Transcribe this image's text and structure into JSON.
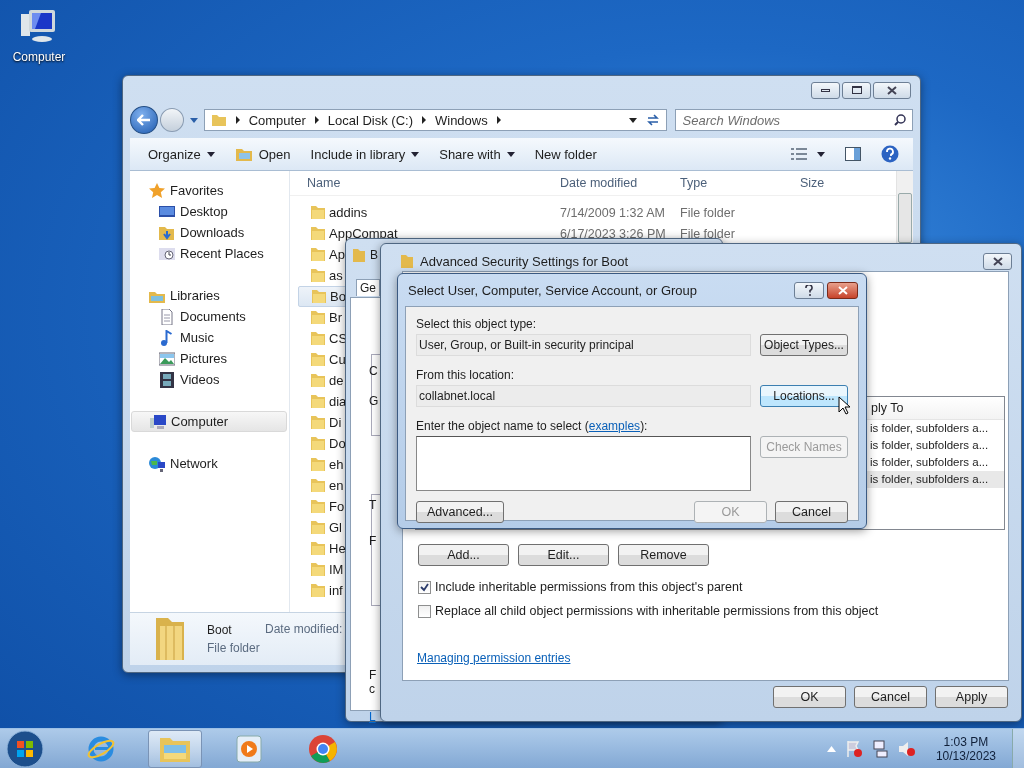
{
  "desktop_icons": [
    {
      "label": "Computer"
    }
  ],
  "explorer": {
    "breadcrumb": [
      "Computer",
      "Local Disk (C:)",
      "Windows"
    ],
    "search": {
      "placeholder": "Search Windows"
    },
    "toolbar": [
      {
        "label": "Organize",
        "kind": "menu"
      },
      {
        "label": "Open",
        "kind": "open"
      },
      {
        "label": "Include in library",
        "kind": "menu"
      },
      {
        "label": "Share with",
        "kind": "menu"
      },
      {
        "label": "New folder",
        "kind": "plain"
      }
    ],
    "sidebar": [
      {
        "label": "Favorites",
        "kind": "star",
        "selected": false,
        "children": [
          {
            "label": "Desktop",
            "kind": "desktop",
            "selected": false
          },
          {
            "label": "Downloads",
            "kind": "downloads",
            "selected": false
          },
          {
            "label": "Recent Places",
            "kind": "recent",
            "selected": false
          }
        ]
      },
      {
        "label": "Libraries",
        "kind": "libraries",
        "selected": false,
        "children": [
          {
            "label": "Documents",
            "kind": "document",
            "selected": false
          },
          {
            "label": "Music",
            "kind": "music",
            "selected": false
          },
          {
            "label": "Pictures",
            "kind": "pictures",
            "selected": false
          },
          {
            "label": "Videos",
            "kind": "videos",
            "selected": false
          }
        ]
      },
      {
        "label": "Computer",
        "kind": "computer",
        "selected": true
      },
      {
        "label": "Network",
        "kind": "network",
        "selected": false
      }
    ],
    "columns": [
      "Name",
      "Date modified",
      "Type",
      "Size"
    ],
    "rows": [
      {
        "name": "addins",
        "date": "7/14/2009 1:32 AM",
        "type": "File folder",
        "selected": false
      },
      {
        "name": "AppCompat",
        "date": "6/17/2023 3:26 PM",
        "type": "File folder",
        "selected": false
      },
      {
        "name": "Ap",
        "selected": false
      },
      {
        "name": "as",
        "selected": false
      },
      {
        "name": "Bo",
        "selected": true
      },
      {
        "name": "Br",
        "selected": false
      },
      {
        "name": "CS",
        "selected": false
      },
      {
        "name": "Cu",
        "selected": false
      },
      {
        "name": "de",
        "selected": false
      },
      {
        "name": "dia",
        "selected": false
      },
      {
        "name": "Di",
        "selected": false
      },
      {
        "name": "Do",
        "selected": false
      },
      {
        "name": "eh",
        "selected": false
      },
      {
        "name": "en",
        "selected": false
      },
      {
        "name": "Fo",
        "selected": false
      },
      {
        "name": "Gl",
        "selected": false
      },
      {
        "name": "He",
        "selected": false
      },
      {
        "name": "IM",
        "selected": false
      },
      {
        "name": "inf",
        "selected": false
      }
    ],
    "details": {
      "name": "Boot",
      "type": "File folder",
      "field": "Date modified:"
    }
  },
  "properties": {
    "title": "B",
    "tab": "Ge",
    "fragments": [
      "C",
      "G",
      "T",
      "F",
      "F",
      "c",
      "L"
    ]
  },
  "advanced": {
    "title": "Advanced Security Settings for Boot",
    "column_header": "ply To",
    "rows": [
      {
        "text": "is folder, subfolders a...",
        "selected": false
      },
      {
        "text": "is folder, subfolders a...",
        "selected": false
      },
      {
        "text": "is folder, subfolders a...",
        "selected": false
      },
      {
        "text": "is folder, subfolders a...",
        "selected": true
      }
    ],
    "buttons": [
      "Add...",
      "Edit...",
      "Remove"
    ],
    "checkboxes": [
      {
        "label": "Include inheritable permissions from this object's parent",
        "checked": true
      },
      {
        "label": "Replace all child object permissions with inheritable permissions from this object",
        "checked": false
      }
    ],
    "link": "Managing permission entries",
    "footer_buttons": [
      "OK",
      "Cancel",
      "Apply"
    ]
  },
  "select_dialog": {
    "title": "Select User, Computer, Service Account, or Group",
    "object_type_label": "Select this object type:",
    "object_type": "User, Group, or Built-in security principal",
    "object_types_button": "Object Types...",
    "location_label": "From this location:",
    "location": "collabnet.local",
    "locations_button": {
      "label": "Locations...",
      "hovered": true
    },
    "name_label_before": "Enter the object name to select (",
    "name_link": "examples",
    "name_label_after": "):",
    "check_names": {
      "label": "Check Names",
      "disabled": true
    },
    "advanced_button": "Advanced...",
    "ok": {
      "label": "OK",
      "disabled": true
    },
    "cancel": "Cancel"
  },
  "taskbar": {
    "apps": [
      {
        "kind": "ie",
        "selected": false
      },
      {
        "kind": "explorer",
        "selected": true
      },
      {
        "kind": "media",
        "selected": false
      },
      {
        "kind": "chrome",
        "selected": false
      }
    ],
    "time": "1:03 PM",
    "date": "10/13/2023"
  }
}
